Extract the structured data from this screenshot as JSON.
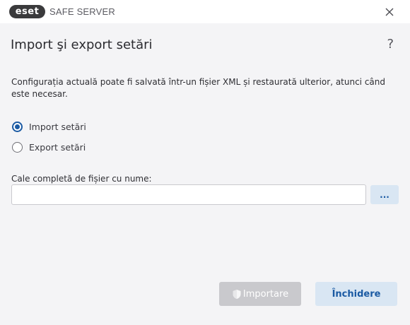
{
  "titlebar": {
    "brand": "eset",
    "product": "SAFE SERVER",
    "close_icon": "close-icon"
  },
  "header": {
    "title": "Import şi export setări",
    "help_label": "?"
  },
  "content": {
    "description": "Configurația actuală poate fi salvată într-un fișier XML și restaurată ulterior, atunci când este necesar.",
    "options": [
      {
        "label": "Import setări",
        "selected": true
      },
      {
        "label": "Export setări",
        "selected": false
      }
    ],
    "path_label": "Cale completă de fișier cu nume:",
    "path_value": "",
    "browse_label": "..."
  },
  "footer": {
    "import_label": "Importare",
    "import_icon": "shield-icon",
    "close_label": "Închidere"
  },
  "colors": {
    "accent": "#1b5aa3",
    "button_secondary_bg": "#d9e6f3",
    "disabled_bg": "#c9c9cd"
  }
}
